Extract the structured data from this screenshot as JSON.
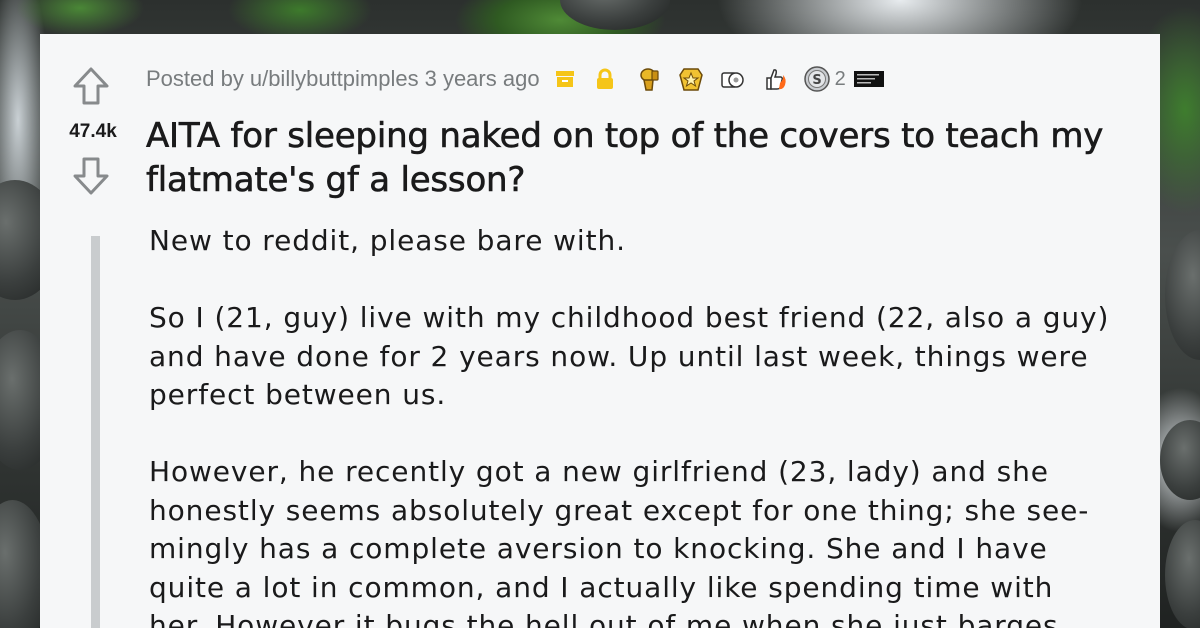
{
  "post": {
    "vote_count": "47.4k",
    "posted_by_prefix": "Posted by",
    "username": "u/billybuttpimples",
    "age": "3 years ago",
    "award_count": "2",
    "awards": [
      "archive-icon",
      "lock-icon",
      "gold-toilet-award-icon",
      "gold-star-award-icon",
      "toilet-paper-award-icon",
      "thumbs-up-fire-award-icon",
      "silver-coin-award-icon",
      "tiny-text-award-icon"
    ],
    "title": "AITA for sleeping naked on top of the covers to teach my flatmate's gf a lesson?",
    "body": {
      "paragraph_1": "New to reddit, please bare with.",
      "paragraph_2": "So I (21, guy) live with my childhood best friend (22, also a guy) and have done for 2 years now. Up until last week, things were perfect between us.",
      "paragraph_3_line_1": "However, he recently got a new girlfriend (23, lady) and she",
      "paragraph_3_line_2": "honestly seems absolutely great except for one thing; she see-",
      "paragraph_3_line_3": "mingly has a complete aversion to knocking. She and I have",
      "paragraph_3_line_4": "quite a lot in common, and I actually like spending time with",
      "paragraph_3_line_5": "her. However it bugs the hell out of me when she just barges"
    }
  },
  "colors": {
    "card_background": "#f6f7f8",
    "text_primary": "#1a1a1b",
    "text_meta": "#787c7e",
    "quote_bar": "#c9ccce",
    "award_yellow": "#f5c518"
  }
}
